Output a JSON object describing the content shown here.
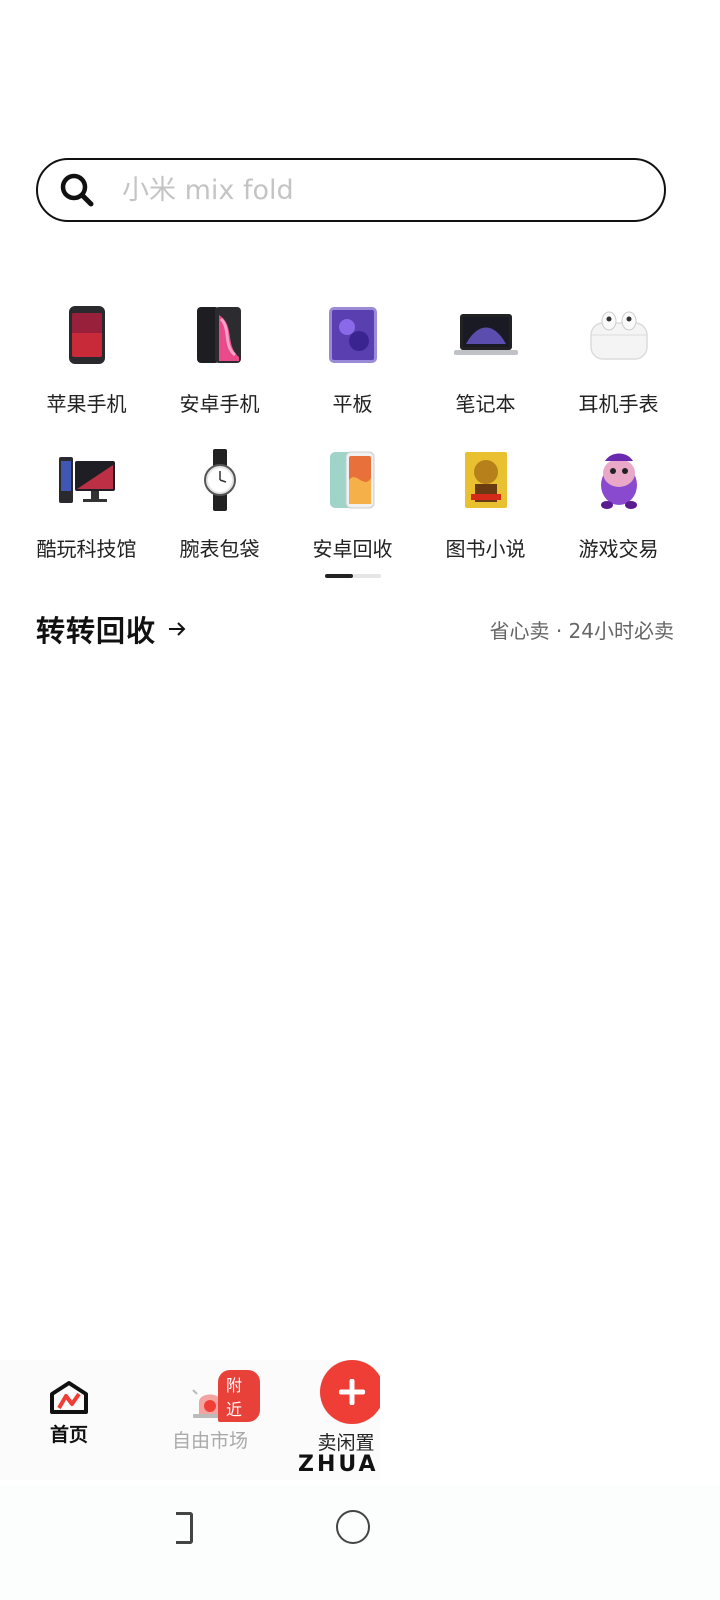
{
  "search": {
    "placeholder": "小米 mix fold",
    "icon": "search-icon"
  },
  "categories": [
    {
      "label": "苹果手机",
      "icon": "iphone-icon"
    },
    {
      "label": "安卓手机",
      "icon": "android-phone-icon"
    },
    {
      "label": "平板",
      "icon": "tablet-icon"
    },
    {
      "label": "笔记本",
      "icon": "laptop-icon"
    },
    {
      "label": "耳机手表",
      "icon": "earbuds-icon"
    },
    {
      "label": "酷玩科技馆",
      "icon": "gaming-pc-icon"
    },
    {
      "label": "腕表包袋",
      "icon": "watch-icon"
    },
    {
      "label": "安卓回收",
      "icon": "phone-recycle-icon"
    },
    {
      "label": "图书小说",
      "icon": "book-icon"
    },
    {
      "label": "游戏交易",
      "icon": "game-character-icon"
    }
  ],
  "recycle": {
    "title": "转转回收",
    "subtitle": "省心卖 · 24小时必卖"
  },
  "tabbar": {
    "home": "首页",
    "market": "自由市场",
    "market_badge": "附近",
    "sell": "卖闲置",
    "brand": "ZHUA"
  },
  "colors": {
    "accent": "#ef3e36",
    "text": "#1a1a1a",
    "muted": "#999999"
  }
}
